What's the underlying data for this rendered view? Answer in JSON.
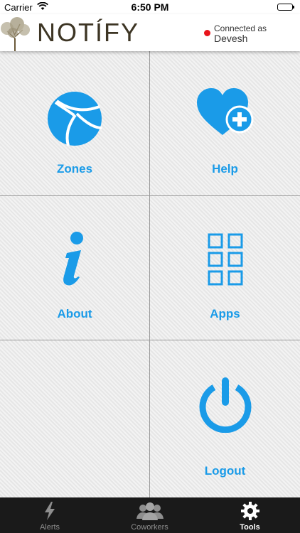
{
  "status_bar": {
    "carrier": "Carrier",
    "time": "6:50 PM"
  },
  "header": {
    "logo_text": "NOTÍFY",
    "connected_label": "Connected as",
    "connected_user": "Devesh",
    "status_color": "#e8141b"
  },
  "tiles": {
    "zones": {
      "label": "Zones",
      "icon": "globe-icon"
    },
    "help": {
      "label": "Help",
      "icon": "heart-plus-icon"
    },
    "about": {
      "label": "About",
      "icon": "info-icon"
    },
    "apps": {
      "label": "Apps",
      "icon": "grid-icon"
    },
    "logout": {
      "label": "Logout",
      "icon": "power-icon"
    }
  },
  "tabbar": {
    "tabs": [
      {
        "label": "Alerts",
        "icon": "lightning-icon",
        "active": false
      },
      {
        "label": "Coworkers",
        "icon": "people-icon",
        "active": false
      },
      {
        "label": "Tools",
        "icon": "gear-icon",
        "active": true
      }
    ]
  },
  "colors": {
    "accent": "#1a9be8",
    "logo": "#3d3524",
    "tabbar_bg": "#1a1a1a"
  }
}
